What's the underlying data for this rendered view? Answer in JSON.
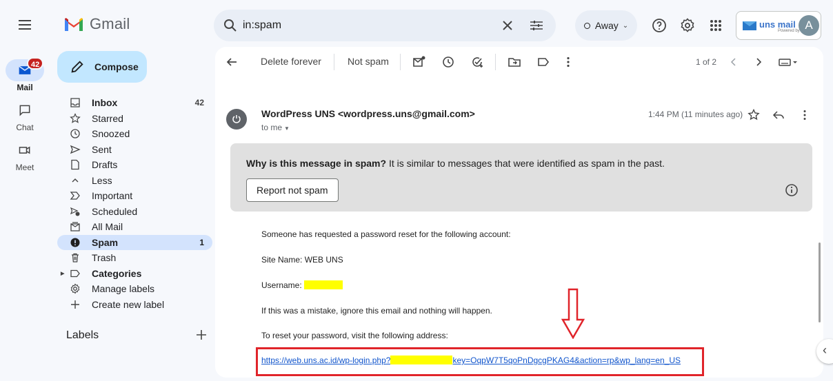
{
  "rail": {
    "mail_label": "Mail",
    "mail_badge": "42",
    "chat_label": "Chat",
    "meet_label": "Meet"
  },
  "header": {
    "app_name": "Gmail",
    "search_value": "in:spam",
    "status_label": "Away",
    "account_brand": "uns mail",
    "account_sub": "Powered by Google",
    "avatar_letter": "A"
  },
  "sidebar": {
    "compose_label": "Compose",
    "items": [
      {
        "label": "Inbox",
        "count": "42"
      },
      {
        "label": "Starred",
        "count": ""
      },
      {
        "label": "Snoozed",
        "count": ""
      },
      {
        "label": "Sent",
        "count": ""
      },
      {
        "label": "Drafts",
        "count": ""
      },
      {
        "label": "Less",
        "count": ""
      },
      {
        "label": "Important",
        "count": ""
      },
      {
        "label": "Scheduled",
        "count": ""
      },
      {
        "label": "All Mail",
        "count": ""
      },
      {
        "label": "Spam",
        "count": "1"
      },
      {
        "label": "Trash",
        "count": ""
      },
      {
        "label": "Categories",
        "count": ""
      },
      {
        "label": "Manage labels",
        "count": ""
      },
      {
        "label": "Create new label",
        "count": ""
      }
    ],
    "labels_heading": "Labels"
  },
  "toolbar": {
    "delete_forever": "Delete forever",
    "not_spam": "Not spam",
    "page_count": "1 of 2"
  },
  "message": {
    "sender": "WordPress UNS <wordpress.uns@gmail.com>",
    "to": "to me",
    "time": "1:44 PM (11 minutes ago)",
    "spam_question": "Why is this message in spam?",
    "spam_reason": " It is similar to messages that were identified as spam in the past.",
    "report_label": "Report not spam",
    "line1": "Someone has requested a password reset for the following account:",
    "line2": "Site Name: WEB UNS",
    "username_label": "Username: ",
    "line4": "If this was a mistake, ignore this email and nothing will happen.",
    "line5": "To reset your password, visit the following address:",
    "link_start": "https://web.uns.ac.id/wp-login.php?",
    "link_end": "key=OqpW7T5qoPnDgcgPKAG4&action=rp&wp_lang=en_US"
  },
  "colors": {
    "accent": "#c2e7ff",
    "active_nav": "#d3e3fd",
    "badge": "#c5221f",
    "annotation": "#e0242a",
    "redaction": "#ffff00"
  }
}
